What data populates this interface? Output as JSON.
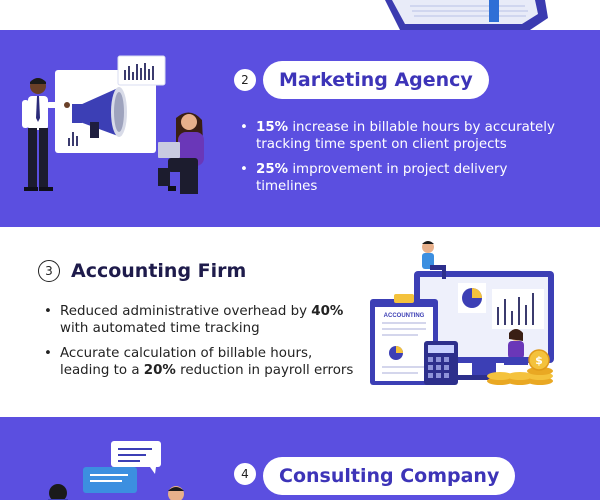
{
  "sections": [
    {
      "number": "2",
      "title": "Marketing Agency",
      "bullets": [
        {
          "highlight": "15%",
          "before": "",
          "after": " increase in billable hours by accurately tracking time spent on client projects"
        },
        {
          "highlight": "25%",
          "before": "",
          "after": " improvement in project delivery timelines"
        }
      ]
    },
    {
      "number": "3",
      "title": "Accounting Firm",
      "illustration_label": "ACCOUNTING",
      "bullets": [
        {
          "before": "Reduced administrative overhead by ",
          "highlight": "40%",
          "after": " with automated time tracking"
        },
        {
          "before": "Accurate calculation of billable hours, leading to a ",
          "highlight": "20%",
          "after": " reduction in payroll errors"
        }
      ]
    },
    {
      "number": "4",
      "title": "Consulting Company"
    }
  ],
  "colors": {
    "band_purple": "#5b4fe0",
    "pill_text": "#3d34b8",
    "dark_title": "#1e1b4b"
  }
}
